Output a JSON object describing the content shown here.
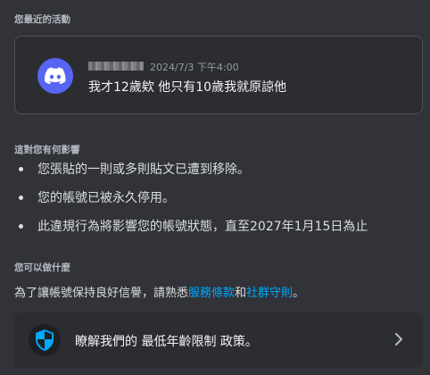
{
  "recent_activity": {
    "section_title": "您最近的活動",
    "message": {
      "timestamp": "2024/7/3 下午4:00",
      "content": "我才12歲欸 他只有10歲我就原諒他"
    }
  },
  "impact": {
    "section_title": "這對您有何影響",
    "items": [
      "您張貼的一則或多則貼文已遭到移除。",
      "您的帳號已被永久停用。",
      "此違規行為將影響您的帳號狀態，直至2027年1月15日為止"
    ]
  },
  "actions": {
    "section_title": "您可以做什麼",
    "guidelines_prefix": "為了讓帳號保持良好信譽，請熟悉",
    "terms_link": "服務條款",
    "conjunction": "和",
    "community_link": "社群守則",
    "guidelines_suffix": "。",
    "age_policy_text": "瞭解我們的 最低年齡限制 政策。"
  },
  "icons": {
    "avatar": "discord-logo-icon",
    "age_policy": "shield-icon",
    "chevron": "chevron-right-icon"
  },
  "colors": {
    "background": "#313338",
    "card": "#2b2d31",
    "blurple": "#5865f2",
    "link": "#00a8fc",
    "shield": "#00a8fc"
  }
}
